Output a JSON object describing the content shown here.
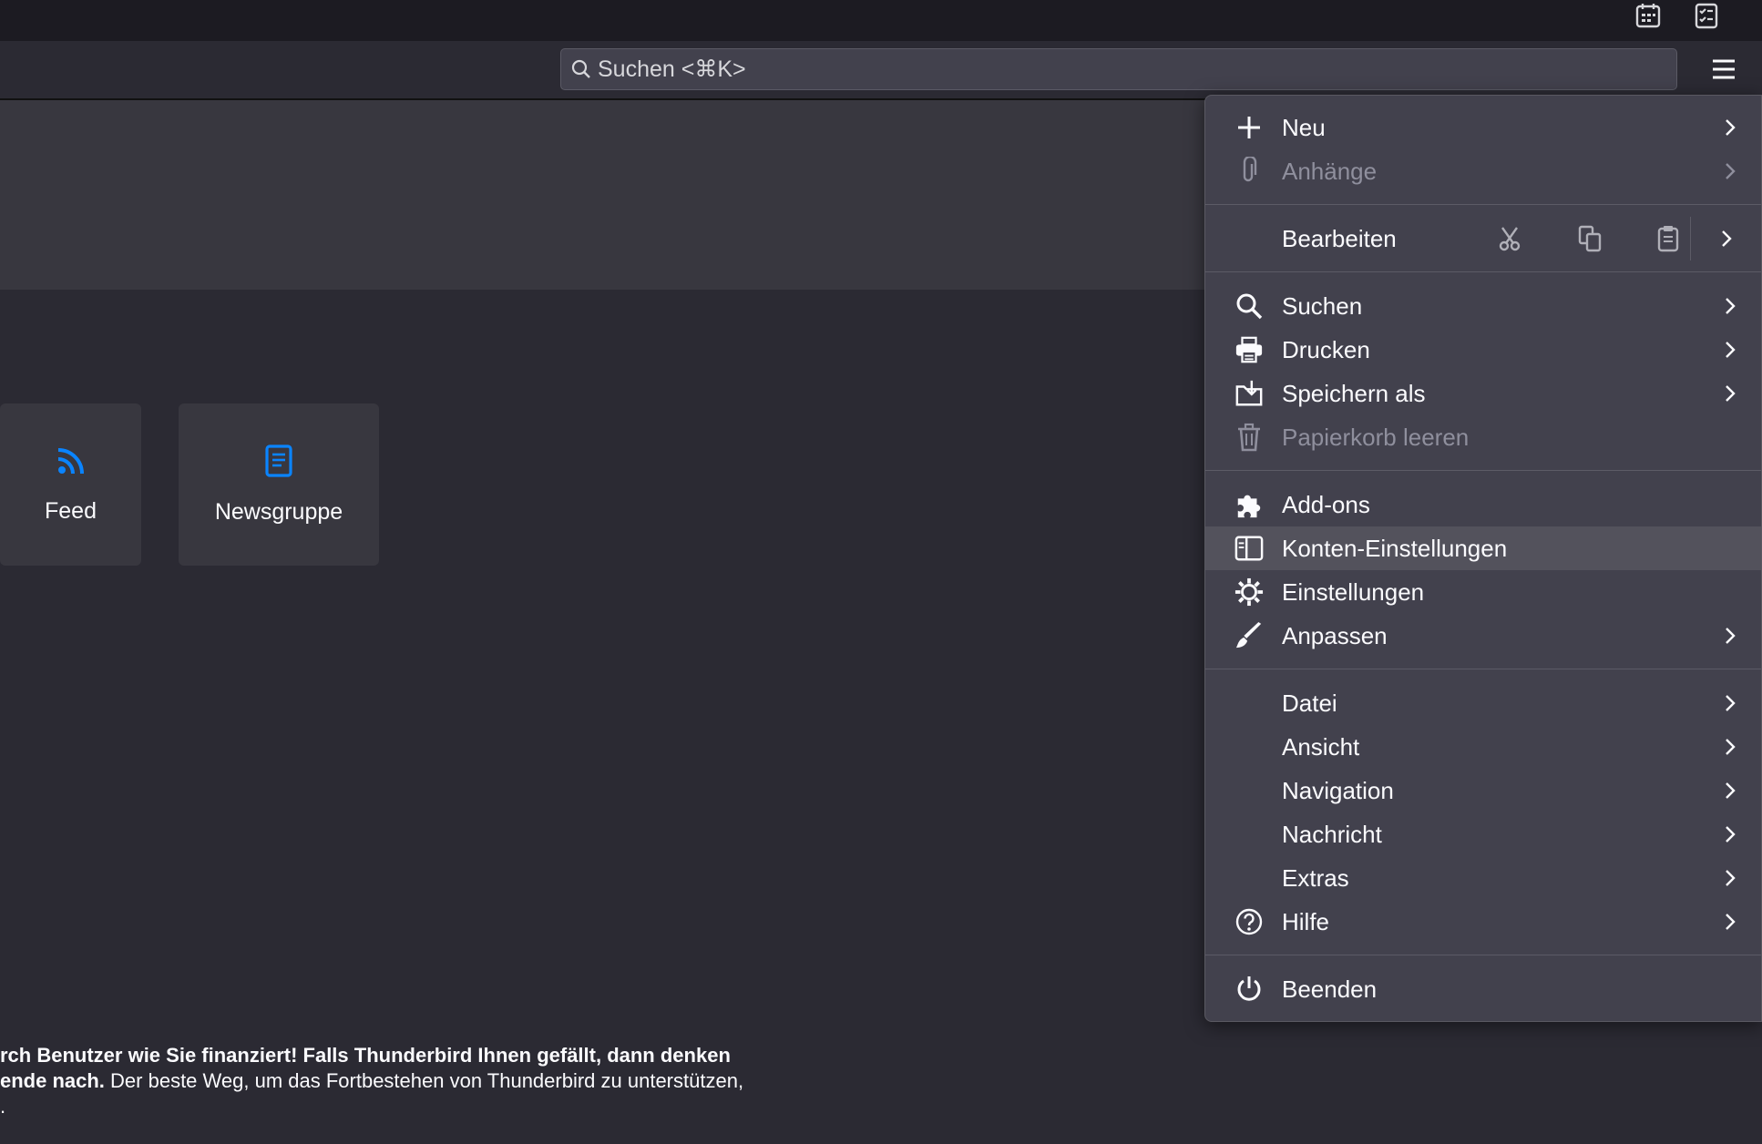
{
  "search": {
    "placeholder": "Suchen <⌘K>"
  },
  "cards": [
    {
      "label": "Feed",
      "icon": "rss-feed-icon"
    },
    {
      "label": "Newsgruppe",
      "icon": "newsgroup-icon"
    }
  ],
  "footer": {
    "line1_bold": "rch Benutzer wie Sie finanziert! Falls Thunderbird Ihnen gefällt, dann denken",
    "line2_bold": "ende nach.",
    "line2_rest": " Der beste Weg, um das Fortbestehen von Thunderbird zu unterstützen,",
    "line3": "."
  },
  "menu": {
    "items": [
      {
        "label": "Neu",
        "icon": "plus-icon",
        "disabled": false,
        "submenu": true
      },
      {
        "label": "Anhänge",
        "icon": "paperclip-icon",
        "disabled": true,
        "submenu": true
      },
      {
        "label": "Bearbeiten",
        "icon": "",
        "disabled": false,
        "submenu": true
      },
      {
        "label": "Suchen",
        "icon": "search-icon",
        "disabled": false,
        "submenu": true
      },
      {
        "label": "Drucken",
        "icon": "printer-icon",
        "disabled": false,
        "submenu": true
      },
      {
        "label": "Speichern als",
        "icon": "save-icon",
        "disabled": false,
        "submenu": true
      },
      {
        "label": "Papierkorb leeren",
        "icon": "trash-icon",
        "disabled": true,
        "submenu": false
      },
      {
        "label": "Add-ons",
        "icon": "puzzle-icon",
        "disabled": false,
        "submenu": false
      },
      {
        "label": "Konten-Einstellungen",
        "icon": "account-settings-icon",
        "disabled": false,
        "submenu": false,
        "highlighted": true
      },
      {
        "label": "Einstellungen",
        "icon": "gear-icon",
        "disabled": false,
        "submenu": false
      },
      {
        "label": "Anpassen",
        "icon": "brush-icon",
        "disabled": false,
        "submenu": true
      },
      {
        "label": "Datei",
        "icon": "",
        "disabled": false,
        "submenu": true
      },
      {
        "label": "Ansicht",
        "icon": "",
        "disabled": false,
        "submenu": true
      },
      {
        "label": "Navigation",
        "icon": "",
        "disabled": false,
        "submenu": true
      },
      {
        "label": "Nachricht",
        "icon": "",
        "disabled": false,
        "submenu": true
      },
      {
        "label": "Extras",
        "icon": "",
        "disabled": false,
        "submenu": true
      },
      {
        "label": "Hilfe",
        "icon": "help-icon",
        "disabled": false,
        "submenu": true
      },
      {
        "label": "Beenden",
        "icon": "power-icon",
        "disabled": false,
        "submenu": false
      }
    ],
    "edit_icons": [
      "cut-icon",
      "copy-icon",
      "paste-icon"
    ]
  },
  "colors": {
    "accent_blue": "#0a84ff",
    "menu_bg": "#42414d",
    "highlight": "#53525c"
  }
}
